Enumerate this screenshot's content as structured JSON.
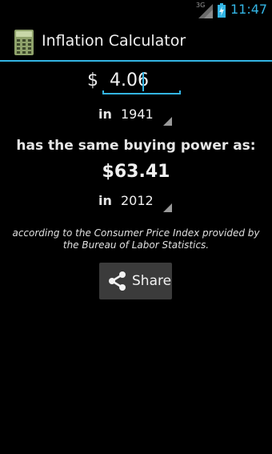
{
  "status_bar": {
    "network_label": "3G",
    "time": "11:47"
  },
  "action_bar": {
    "title": "Inflation Calculator"
  },
  "form": {
    "currency_symbol": "$",
    "amount_value": "4.06",
    "from_prefix": "in",
    "from_year": "1941",
    "headline": "has the same buying power as:",
    "result_value": "$63.41",
    "to_prefix": "in",
    "to_year": "2012",
    "footnote": "according to the Consumer Price Index provided by the Bureau of Labor Statistics.",
    "share_label": "Share"
  },
  "colors": {
    "accent": "#33b5e5",
    "background": "#000000",
    "button": "#3b3b3b"
  }
}
